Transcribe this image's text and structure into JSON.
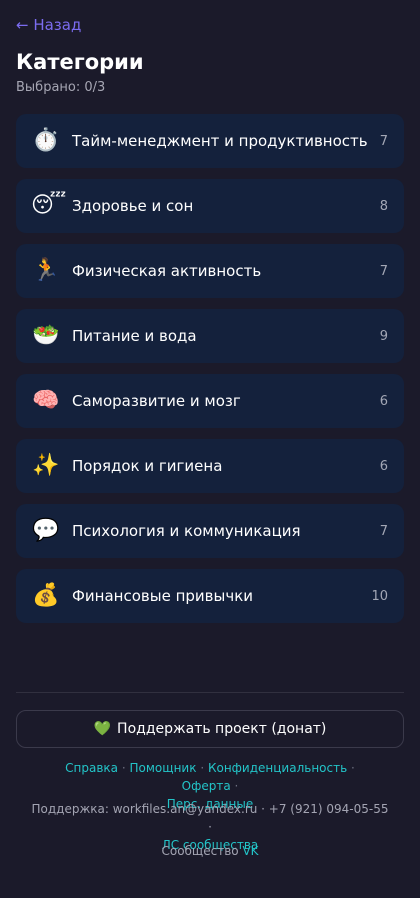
{
  "header": {
    "back_label": "← Назад",
    "title": "Категории",
    "selected_text": "Выбрано: 0/3"
  },
  "categories": [
    {
      "emoji": "⏱️",
      "icon": "stopwatch-icon",
      "label": "Тайм-менеджмент и продуктивность",
      "count": "7"
    },
    {
      "emoji": "😴",
      "icon": "sleeping-face-icon",
      "label": "Здоровье и сон",
      "count": "8"
    },
    {
      "emoji": "🏃",
      "icon": "running-person-icon",
      "label": "Физическая активность",
      "count": "7"
    },
    {
      "emoji": "🥗",
      "icon": "salad-bowl-icon",
      "label": "Питание и вода",
      "count": "9"
    },
    {
      "emoji": "🧠",
      "icon": "brain-icon",
      "label": "Саморазвитие и мозг",
      "count": "6"
    },
    {
      "emoji": "✨",
      "icon": "sparkles-icon",
      "label": "Порядок и гигиена",
      "count": "6"
    },
    {
      "emoji": "💬",
      "icon": "speech-bubble-icon",
      "label": "Психология и коммуникация",
      "count": "7"
    },
    {
      "emoji": "💰",
      "icon": "money-bag-icon",
      "label": "Финансовые привычки",
      "count": "10"
    }
  ],
  "donate": {
    "icon": "green-heart-icon",
    "emoji": "💚",
    "label": "Поддержать проект (донат)"
  },
  "footer": {
    "links": [
      "Справка",
      "Помощник",
      "Конфиденциальность",
      "Оферта",
      "Перс. данные"
    ],
    "separator": "·",
    "support_prefix": "Поддержка: workfiles.an@yandex.ru · +7 (921) 094-05-55 ·",
    "support_link": "ЛС сообщества",
    "community_prefix": "Сообщество",
    "community_link": "VK"
  },
  "colors": {
    "background": "#1b1a2a",
    "card": "#14213c",
    "accent": "#7b6cf0",
    "link": "#23c4c8"
  }
}
